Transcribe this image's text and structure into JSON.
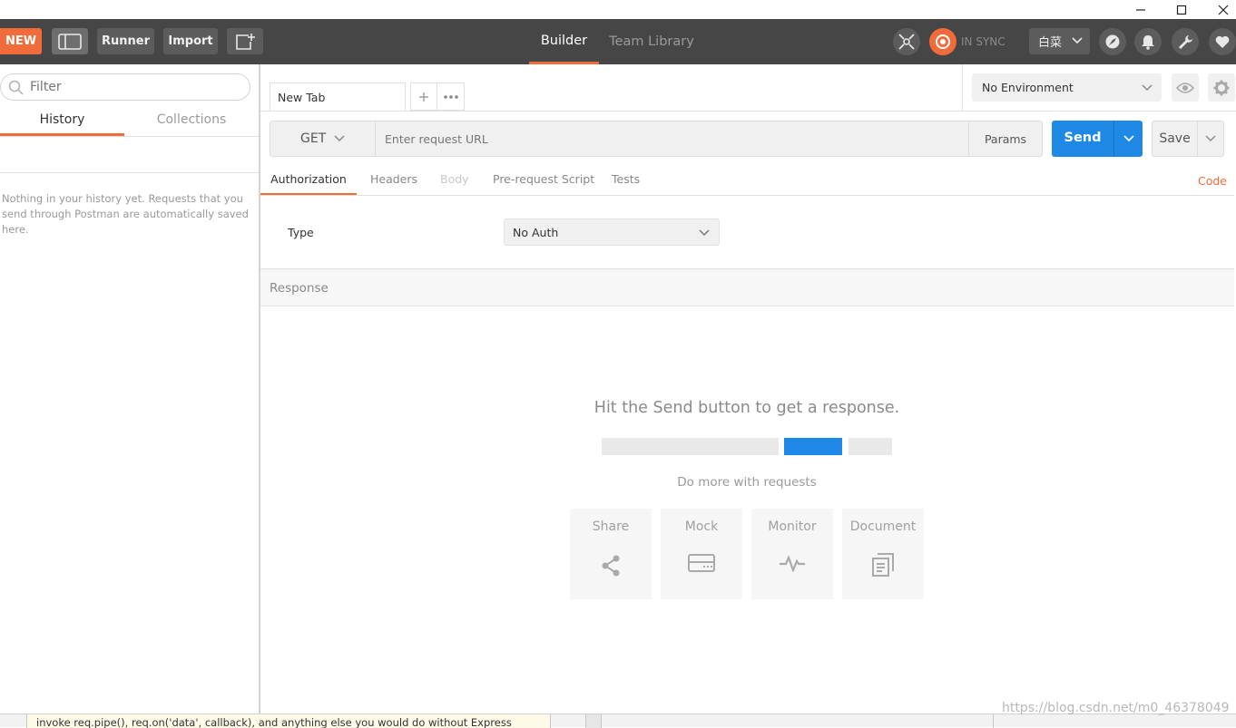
{
  "window": {
    "minimize_icon": "minimize-icon",
    "maximize_icon": "maximize-icon",
    "close_icon": "close-icon"
  },
  "header": {
    "new_label": "NEW",
    "runner_label": "Runner",
    "import_label": "Import",
    "tabs": [
      {
        "label": "Builder",
        "active": true
      },
      {
        "label": "Team Library",
        "active": false
      }
    ],
    "sync_status": "IN SYNC",
    "theme_label": "白菜",
    "accent_color": "#f26b3a"
  },
  "sidebar": {
    "filter_placeholder": "Filter",
    "tabs": [
      {
        "label": "History",
        "active": true
      },
      {
        "label": "Collections",
        "active": false
      }
    ],
    "empty_message": "Nothing in your history yet. Requests that you send through Postman are automatically saved here."
  },
  "request_tabs": {
    "current": "New Tab"
  },
  "environment": {
    "selected": "No Environment"
  },
  "request": {
    "method": "GET",
    "url_placeholder": "Enter request URL",
    "params_label": "Params",
    "send_label": "Send",
    "save_label": "Save",
    "send_color": "#1e88e5"
  },
  "request_subtabs": [
    {
      "label": "Authorization",
      "active": true,
      "disabled": false
    },
    {
      "label": "Headers",
      "active": false,
      "disabled": false
    },
    {
      "label": "Body",
      "active": false,
      "disabled": true
    },
    {
      "label": "Pre-request Script",
      "active": false,
      "disabled": false
    },
    {
      "label": "Tests",
      "active": false,
      "disabled": false
    }
  ],
  "code_link": "Code",
  "auth": {
    "type_label": "Type",
    "type_value": "No Auth"
  },
  "response": {
    "title": "Response",
    "hint": "Hit the Send button to get a response.",
    "more_label": "Do more with requests",
    "cards": [
      {
        "label": "Share",
        "icon": "share-icon"
      },
      {
        "label": "Mock",
        "icon": "mock-server-icon"
      },
      {
        "label": "Monitor",
        "icon": "monitor-pulse-icon"
      },
      {
        "label": "Document",
        "icon": "document-icon"
      }
    ]
  },
  "background": {
    "code_line": "invoke req.pipe(), req.on('data', callback), and anything else you would do without Express",
    "watermark": "https://blog.csdn.net/m0_46378049"
  }
}
